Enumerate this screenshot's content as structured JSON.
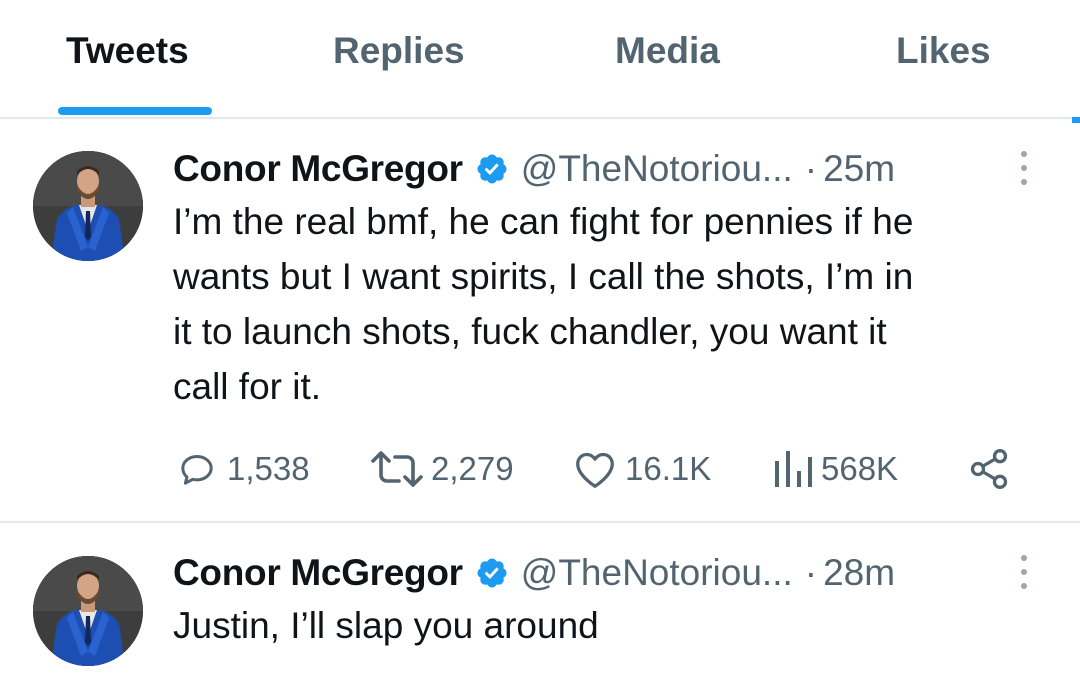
{
  "tabs": [
    {
      "label": "Tweets",
      "active": true
    },
    {
      "label": "Replies",
      "active": false
    },
    {
      "label": "Media",
      "active": false
    },
    {
      "label": "Likes",
      "active": false
    }
  ],
  "colors": {
    "accent": "#1d9bf0",
    "secondary_text": "#536471",
    "primary_text": "#0f1419"
  },
  "tweets": [
    {
      "name": "Conor McGregor",
      "handle": "@TheNotoriou...",
      "separator": "·",
      "time": "25m",
      "text_lines": [
        "I’m the real bmf, he can fight for pennies if he",
        "wants but I want spirits, I call the shots, I’m in",
        "it to launch shots, fuck chandler, you want it",
        "call for it."
      ],
      "stats": {
        "replies": "1,538",
        "retweets": "2,279",
        "likes": "16.1K",
        "views": "568K"
      },
      "icons": [
        "reply-icon",
        "retweet-icon",
        "like-icon",
        "views-icon",
        "share-icon"
      ]
    },
    {
      "name": "Conor McGregor",
      "handle": "@TheNotoriou...",
      "separator": "·",
      "time": "28m",
      "text_lines": [
        "Justin, I’ll slap you around"
      ]
    }
  ]
}
